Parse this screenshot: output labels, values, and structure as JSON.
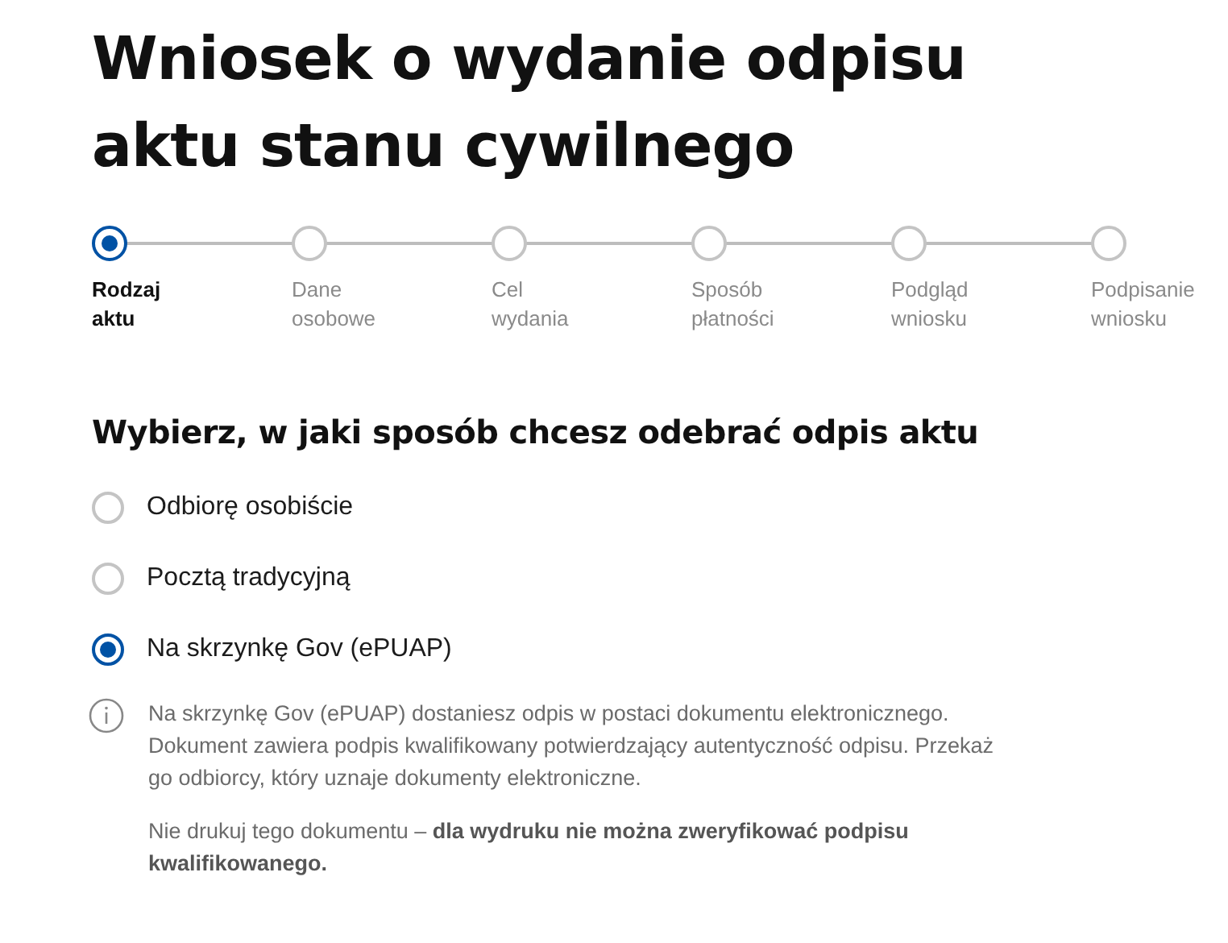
{
  "title": "Wniosek o wydanie odpisu aktu stanu cywilnego",
  "steps": [
    {
      "label": "Rodzaj aktu",
      "selected": true
    },
    {
      "label": "Dane osobowe",
      "selected": false
    },
    {
      "label": "Cel wydania",
      "selected": false
    },
    {
      "label": "Sposób płatności",
      "selected": false
    },
    {
      "label": "Podgląd wniosku",
      "selected": false
    },
    {
      "label": "Podpisanie wniosku",
      "selected": false
    }
  ],
  "question": "Wybierz, w jaki sposób chcesz odebrać odpis aktu",
  "options": [
    {
      "label": "Odbiorę osobiście",
      "selected": false
    },
    {
      "label": "Pocztą tradycyjną",
      "selected": false
    },
    {
      "label": "Na skrzynkę Gov (ePUAP)",
      "selected": true
    }
  ],
  "info": [
    "Na skrzynkę Gov (ePUAP) dostaniesz odpis w postaci dokumentu elektronicznego. Dokument zawiera podpis kwalifikowany potwierdzający autentyczność odpisu. Przekaż go odbiorcy, który uznaje dokumenty elektroniczne.",
    "Nie drukuj tego dokumentu – **dla wydruku nie można zweryfikować podpisu kwalifikowanego.**"
  ]
}
